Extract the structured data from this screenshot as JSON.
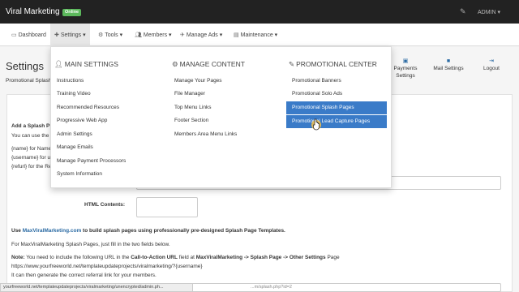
{
  "topbar": {
    "brand": "Viral Marketing",
    "badge": "Online",
    "user_menu": "ADMIN ▾",
    "tool_icon": "wrench-icon"
  },
  "nav": {
    "dashboard": "Dashboard",
    "settings": "Settings ▾",
    "tools": "Tools ▾",
    "members": "Members ▾",
    "manage_ads": "Manage Ads ▾",
    "maintenance": "Maintenance ▾"
  },
  "page": {
    "title": "Settings",
    "breadcrumb": "Promotional Splash",
    "tools": [
      {
        "icon": "payments-icon",
        "label": "Payments Settings"
      },
      {
        "icon": "mail-icon",
        "label": "Mail Settings"
      },
      {
        "icon": "logout-icon",
        "label": "Logout"
      }
    ]
  },
  "menu": {
    "main_settings": {
      "heading": "MAIN SETTINGS",
      "items": [
        "Instructions",
        "Training Video",
        "Recommended Resources",
        "Progressive Web App",
        "Admin Settings",
        "Manage Emails",
        "Manage Payment Processors",
        "System Information"
      ]
    },
    "manage_content": {
      "heading": "MANAGE CONTENT",
      "items": [
        "Manage Your Pages",
        "File Manager",
        "Top Menu Links",
        "Footer Section",
        "Members Area Menu Links"
      ]
    },
    "promotional_center": {
      "heading": "PROMOTIONAL CENTER",
      "items": [
        "Promotional Banners",
        "Promotional Solo Ads",
        "Promotional Splash Pages",
        "Promotional Lead Capture Pages"
      ]
    }
  },
  "form": {
    "add_heading": "Add a Splash P",
    "intro": "You can use the",
    "tag_name": "{name} for Name",
    "tag_username": "{username} for u",
    "tag_refurl": "{refurl} for the Re",
    "html_label": "HTML Contents:",
    "use_prefix": "Use ",
    "use_link": "MaxViralMarketing.com",
    "use_suffix": " to build splash pages using professionally pre-designed Splash Page Templates.",
    "fill_note": "For MaxViralMarketing Splash Pages, just fill in the two fields below.",
    "note_label": "Note:",
    "note_1": " You need to include the following URL in the ",
    "note_cta": "Call-to-Action URL",
    "note_2": " field at ",
    "note_path": "MaxViralMarketing -> Splash Page -> Other Settings",
    "note_3": " Page",
    "note_url": "https://www.yourfreeworld.net/templateupdateprojects/viralmarketing/?{username}",
    "note_final": "It can then generate the correct referral link for your members.",
    "bottom_url": "...m/splash.php?id=2"
  },
  "status_url": "yourfreeworld.net/templateupdateprojects/viralmarketing/unencrypted/admin.ph..."
}
